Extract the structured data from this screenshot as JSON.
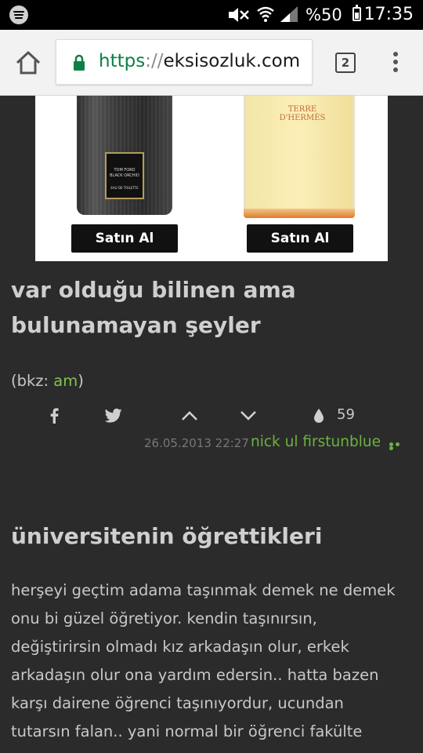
{
  "status_bar": {
    "battery": "%50",
    "time": "17:35"
  },
  "browser": {
    "url_scheme": "https",
    "url_sep": "://",
    "url_host": "eksisozluk.com",
    "tab_count": "2"
  },
  "ad": {
    "product1_label_line1": "TOM FORD",
    "product1_label_line2": "BLACK ORCHID",
    "product1_label_line3": "EAU DE TOILETTE",
    "product2_brand_line1": "TERRE",
    "product2_brand_line2": "D'HERMÈS",
    "buy_label_1": "Satın Al",
    "buy_label_2": "Satın Al"
  },
  "entry1": {
    "title_line1": "var olduğu bilinen ama",
    "title_line2": "bulunamayan şeyler",
    "text_prefix": "(bkz: ",
    "text_link": "am",
    "text_suffix": ")",
    "fav_count": "59",
    "date": "26.05.2013 22:27",
    "author": "nick ul firstunblue"
  },
  "entry2": {
    "title": "üniversitenin öğrettikleri",
    "lines": [
      "herşeyi geçtim adama taşınmak demek ne demek",
      "onu bi güzel öğretiyor. kendin taşınırsın,",
      "değiştirirsin olmadı kız arkadaşın olur, erkek",
      "arkadaşın olur ona yardım edersin.. hatta bazen",
      "karşı dairene öğrenci taşınıyordur, ucundan",
      "tutarsın falan.. yani normal bir öğrenci fakülte"
    ]
  },
  "icons": [
    "spotify-icon",
    "mute-icon",
    "wifi-icon",
    "signal-icon",
    "battery-icon",
    "home-icon",
    "lock-icon",
    "tabs-icon",
    "menu-icon",
    "facebook-icon",
    "twitter-icon",
    "upvote-icon",
    "downvote-icon",
    "drop-icon",
    "more-icon"
  ],
  "colors": {
    "background": "#2b2b2b",
    "link": "#81c14b",
    "author": "#6cb33f",
    "https": "#0b8043"
  }
}
